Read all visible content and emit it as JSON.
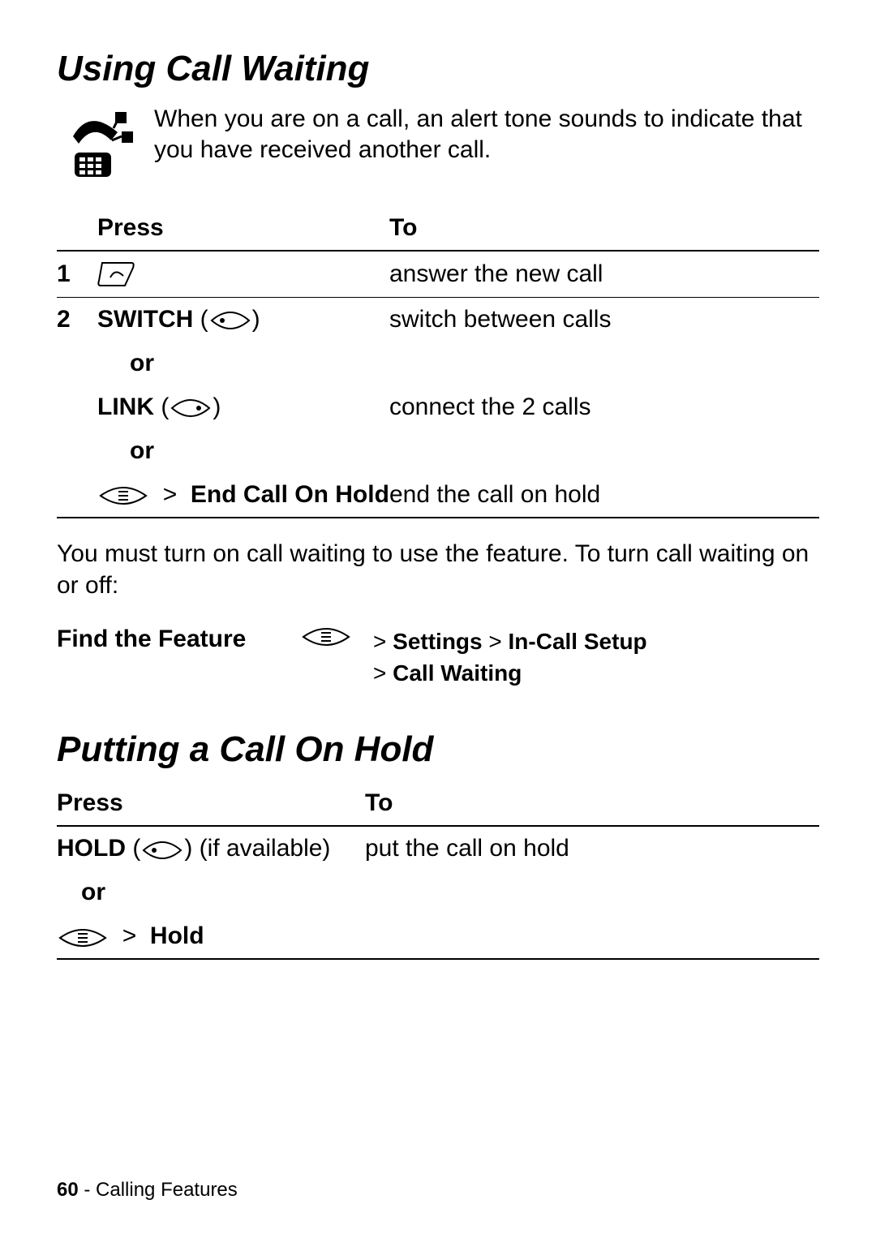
{
  "section1": {
    "title": "Using Call Waiting",
    "intro": "When you are on a call, an alert tone sounds to indicate that you have received another call.",
    "table_headers": {
      "press": "Press",
      "to": "To"
    },
    "steps": {
      "s1": {
        "num": "1",
        "to": "answer the new call"
      },
      "s2": {
        "num": "2",
        "switch_label": "SWITCH",
        "switch_to": "switch between calls",
        "or1": "or",
        "link_label": "LINK",
        "link_to": "connect the 2 calls",
        "or2": "or",
        "endhold_label": "End Call On Hold",
        "endhold_to": "end the call on hold"
      }
    },
    "note": "You must turn on call waiting to use the feature. To turn call waiting on or off:",
    "find_feature_label": "Find the Feature",
    "nav_path_line1_a": "Settings",
    "nav_path_line1_b": "In-Call Setup",
    "nav_path_line2": "Call Waiting"
  },
  "section2": {
    "title": "Putting a Call On Hold",
    "table_headers": {
      "press": "Press",
      "to": "To"
    },
    "hold_label": "HOLD",
    "hold_avail": "(if available)",
    "hold_to": "put the call on hold",
    "or": "or",
    "menu_hold": "Hold"
  },
  "footer": {
    "page_number": "60",
    "dash": " - ",
    "chapter": "Calling Features"
  },
  "glyph": {
    "gt": ">"
  }
}
